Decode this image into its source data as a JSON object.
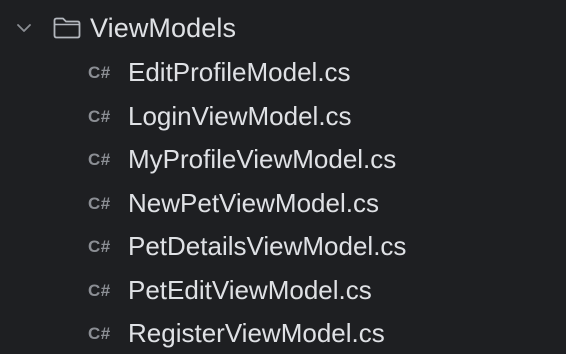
{
  "project_tree": {
    "folder": {
      "name": "ViewModels",
      "expanded": true,
      "chevron_icon": "chevron-down-icon",
      "icon": "folder-icon"
    },
    "file_icon_text": "C#",
    "files": [
      {
        "name": "EditProfileModel.cs"
      },
      {
        "name": "LoginViewModel.cs"
      },
      {
        "name": "MyProfileViewModel.cs"
      },
      {
        "name": "NewPetViewModel.cs"
      },
      {
        "name": "PetDetailsViewModel.cs"
      },
      {
        "name": "PetEditViewModel.cs"
      },
      {
        "name": "RegisterViewModel.cs"
      }
    ]
  },
  "colors": {
    "background": "#1e1f22",
    "text": "#dfe1e5",
    "icon": "#8b8e94"
  }
}
